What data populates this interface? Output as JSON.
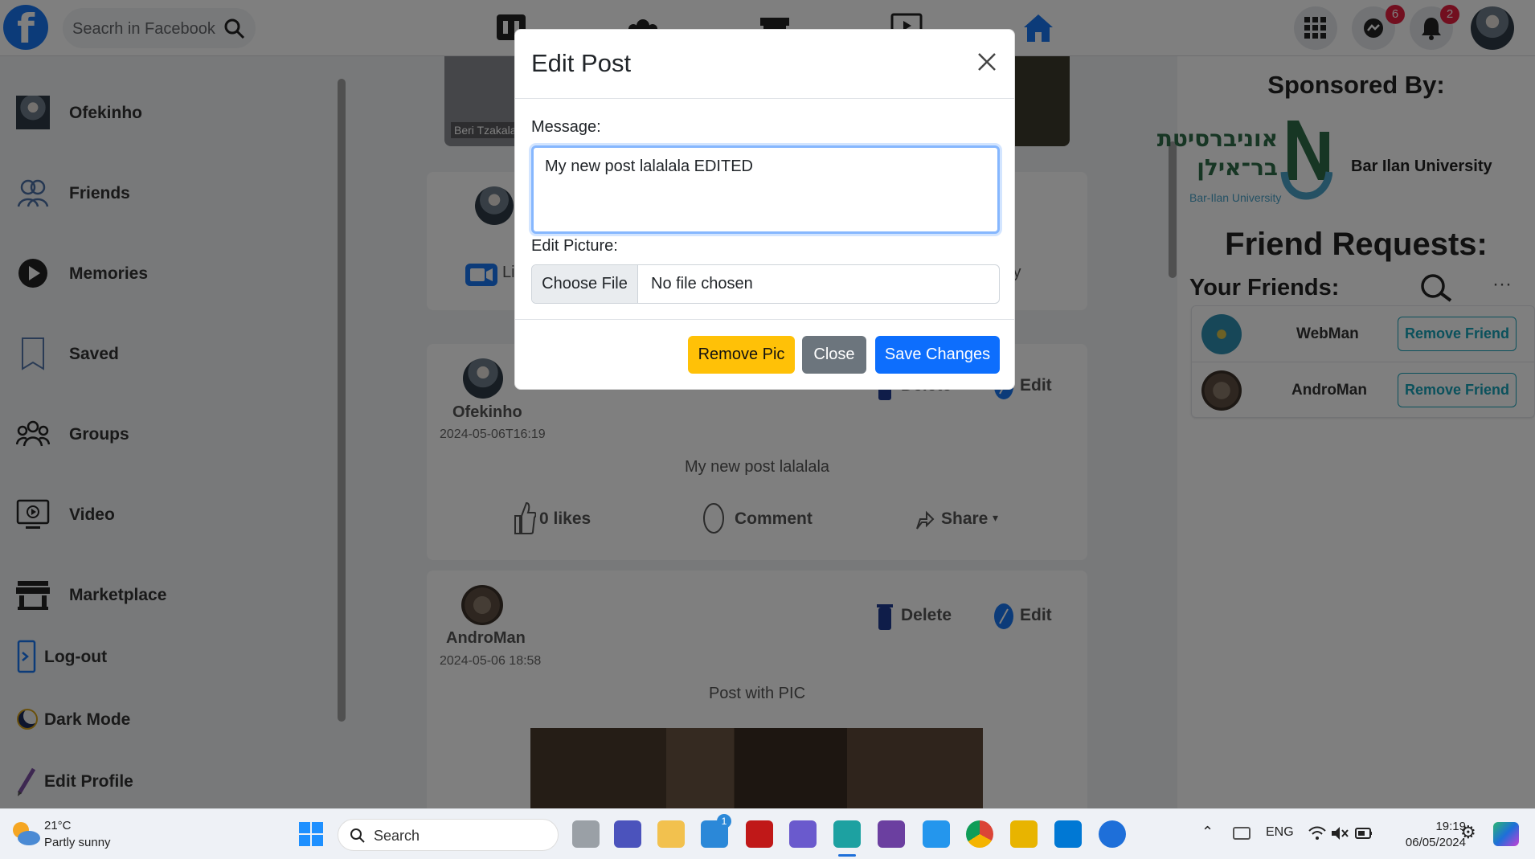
{
  "header": {
    "logo": "f",
    "search_placeholder": "Seacrh in Facebook",
    "messenger_badge": "6",
    "notifications_badge": "2"
  },
  "left_sidebar": {
    "items": [
      {
        "label": "Ofekinho",
        "icon": "user-avatar"
      },
      {
        "label": "Friends",
        "icon": "friends-icon"
      },
      {
        "label": "Memories",
        "icon": "memories-icon"
      },
      {
        "label": "Saved",
        "icon": "bookmark-icon"
      },
      {
        "label": "Groups",
        "icon": "groups-icon"
      },
      {
        "label": "Video",
        "icon": "video-icon"
      },
      {
        "label": "Marketplace",
        "icon": "marketplace-icon"
      },
      {
        "label": "Log-out",
        "icon": "logout-icon"
      },
      {
        "label": "Dark Mode",
        "icon": "moon-icon"
      },
      {
        "label": "Edit Profile",
        "icon": "pencil-icon"
      }
    ]
  },
  "feed": {
    "story_caption": "Beri Tzakala",
    "composer_live": "Li",
    "composer_right": "ty",
    "posts": [
      {
        "author": "Ofekinho",
        "date": "2024-05-06T16:19",
        "text": "My new post lalalala",
        "delete_label": "Delete",
        "edit_label": "Edit",
        "likes_label": "0 likes",
        "comment_label": "Comment",
        "share_label": "Share"
      },
      {
        "author": "AndroMan",
        "date": "2024-05-06 18:58",
        "text": "Post with PIC",
        "delete_label": "Delete",
        "edit_label": "Edit"
      }
    ]
  },
  "right_sidebar": {
    "sponsored_title": "Sponsored By:",
    "sponsor_name": "Bar Ilan University",
    "sponsor_logo_hebrew_1": "אוניברסיטת",
    "sponsor_logo_hebrew_2": "בר־אילן",
    "sponsor_logo_english": "Bar-Ilan University",
    "friend_requests_title": "Friend Requests:",
    "friends_title": "Your Friends:",
    "more_label": "···",
    "friends": [
      {
        "name": "WebMan",
        "button": "Remove Friend"
      },
      {
        "name": "AndroMan",
        "button": "Remove Friend"
      }
    ]
  },
  "modal": {
    "title": "Edit Post",
    "message_label": "Message:",
    "message_value": "My new post lalalala EDITED",
    "picture_label": "Edit Picture:",
    "choose_file": "Choose File",
    "no_file": "No file chosen",
    "remove_pic": "Remove Pic",
    "close": "Close",
    "save": "Save Changes",
    "colors": {
      "remove": "#ffc107",
      "close": "#6c757d",
      "save": "#0d6efd"
    }
  },
  "taskbar": {
    "weather_temp": "21°C",
    "weather_desc": "Partly sunny",
    "search_label": "Search",
    "language": "ENG",
    "time": "19:19",
    "date": "06/05/2024",
    "store_badge": "1"
  }
}
